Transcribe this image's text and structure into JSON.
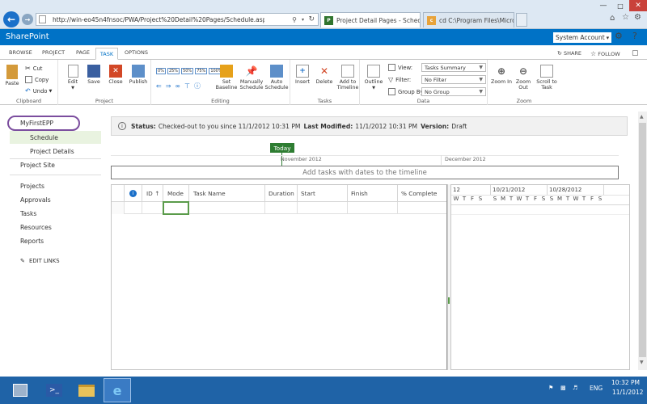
{
  "browser": {
    "address": "http://win-eo45n4fnsoc/PWA/Project%20Detail%20Pages/Schedule.aspx?ProjUid=03e29e92",
    "tabs": [
      {
        "label": "Project Detail Pages - Sched..."
      },
      {
        "label": "cd C:\\Program Files\\Microsoft ..."
      }
    ]
  },
  "suite": {
    "brand": "SharePoint",
    "account": "System Account",
    "account_arrow": "▾"
  },
  "ribbon": {
    "tabs": [
      "BROWSE",
      "PROJECT",
      "PAGE",
      "TASK",
      "OPTIONS"
    ],
    "share": "SHARE",
    "follow": "FOLLOW",
    "groups": {
      "clipboard": {
        "label": "Clipboard",
        "paste": "Paste",
        "cut": "Cut",
        "copy": "Copy",
        "undo": "Undo"
      },
      "project": {
        "label": "Project",
        "edit": "Edit",
        "save": "Save",
        "close": "Close",
        "publish": "Publish"
      },
      "editing": {
        "label": "Editing",
        "percents": [
          "0%",
          "25%",
          "50%",
          "75%",
          "100%"
        ],
        "set_baseline": "Set Baseline",
        "manually_schedule": "Manually Schedule",
        "auto_schedule": "Auto Schedule"
      },
      "tasks": {
        "label": "Tasks",
        "insert": "Insert",
        "delete": "Delete",
        "add_to_timeline": "Add to Timeline"
      },
      "data": {
        "label": "Data",
        "outline": "Outline",
        "view_label": "View:",
        "view_value": "Tasks Summary",
        "filter_label": "Filter:",
        "filter_value": "No Filter",
        "group_label": "Group By:",
        "group_value": "No Group"
      },
      "zoom": {
        "label": "Zoom",
        "zoom_in": "Zoom In",
        "zoom_out": "Zoom Out",
        "scroll_to_task": "Scroll to Task"
      }
    }
  },
  "leftnav": {
    "project_name": "MyFirstEPP",
    "schedule": "Schedule",
    "project_details": "Project Details",
    "project_site": "Project Site",
    "projects": "Projects",
    "approvals": "Approvals",
    "tasks": "Tasks",
    "resources": "Resources",
    "reports": "Reports",
    "edit_links": "EDIT LINKS"
  },
  "status": {
    "status_label": "Status:",
    "status_value": "Checked-out to you since 11/1/2012 10:31 PM",
    "modified_label": "Last Modified:",
    "modified_value": "11/1/2012 10:31 PM",
    "version_label": "Version:",
    "version_value": "Draft"
  },
  "timeline": {
    "today": "Today",
    "month1": "November 2012",
    "month2": "December 2012",
    "placeholder": "Add tasks with dates to the timeline"
  },
  "grid": {
    "columns": [
      "ID ↑",
      "Mode",
      "Task Name",
      "Duration",
      "Start",
      "Finish",
      "% Complete"
    ]
  },
  "gantt": {
    "weeks": [
      "12",
      "10/21/2012",
      "10/28/2012"
    ],
    "days": [
      "W",
      "T",
      "F",
      "S",
      "S",
      "M",
      "T",
      "W",
      "T",
      "F",
      "S",
      "S",
      "M",
      "T",
      "W",
      "T",
      "F",
      "S"
    ]
  },
  "taskbar": {
    "lang": "ENG",
    "time": "10:32 PM",
    "date": "11/1/2012"
  },
  "colors": {
    "suite_blue": "#0072c6",
    "taskbar": "#1f63a7",
    "today_green": "#2e7d32",
    "nav_highlight": "#e9f3e0"
  }
}
